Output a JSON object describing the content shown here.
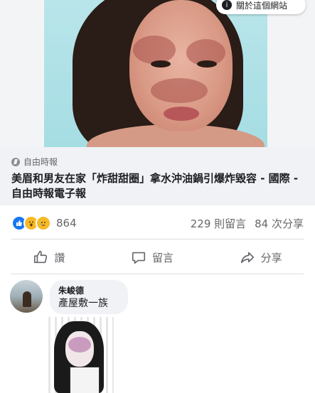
{
  "overlay": {
    "about_label": "關於這個網站"
  },
  "link_preview": {
    "source": "自由時報",
    "headline": "美眉和男友在家「炸甜甜圈」拿水沖油鍋引爆炸毀容 - 國際 - 自由時報電子報"
  },
  "stats": {
    "reaction_count": "864",
    "comments": "229 則留言",
    "shares": "84 次分享",
    "reaction_icons": [
      "like-icon",
      "wow-icon",
      "sad-icon"
    ]
  },
  "actions": {
    "like": "讚",
    "comment": "留言",
    "share": "分享"
  },
  "comment": {
    "author": "朱峻德",
    "text": "產屋敷一族"
  },
  "colors": {
    "link_box_bg": "#f0f2f5",
    "like_blue": "#1877f2",
    "wow_yellow": "#f7b928",
    "secondary_text": "#65676b"
  }
}
